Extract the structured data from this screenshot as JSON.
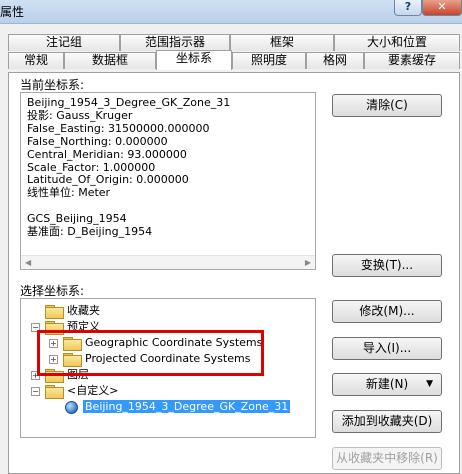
{
  "window": {
    "title": "属性",
    "help_label": "?",
    "close_label": "✕"
  },
  "tabs": {
    "row1": [
      "注记组",
      "范围指示器",
      "框架",
      "大小和位置"
    ],
    "row2": [
      "常规",
      "数据框",
      "坐标系",
      "照明度",
      "格网",
      "要素缓存"
    ],
    "active": "坐标系"
  },
  "current_cs": {
    "label": "当前坐标系:",
    "text": "Beijing_1954_3_Degree_GK_Zone_31\n投影: Gauss_Kruger\nFalse_Easting: 31500000.000000\nFalse_Northing: 0.000000\nCentral_Meridian: 93.000000\nScale_Factor: 1.000000\nLatitude_Of_Origin: 0.000000\n线性单位: Meter\n\nGCS_Beijing_1954\n基准面: D_Beijing_1954"
  },
  "select_cs": {
    "label": "选择坐标系:"
  },
  "tree": {
    "favorites": "收藏夹",
    "predefined": "预定义",
    "geographic": "Geographic Coordinate Systems",
    "projected": "Projected Coordinate Systems",
    "layers": "图层",
    "custom": "<自定义>",
    "custom_item": "Beijing_1954_3_Degree_GK_Zone_31"
  },
  "buttons": {
    "clear": "清除(C)",
    "transform": "变换(T)...",
    "modify": "修改(M)...",
    "import": "导入(I)...",
    "new": "新建(N)",
    "add_favorite": "添加到收藏夹(D)",
    "remove_favorite": "从收藏夹中移除(R)"
  },
  "icons": {
    "expand": "plus-box-icon",
    "collapse": "minus-box-icon",
    "folder": "folder-icon",
    "globe": "globe-icon"
  },
  "colors": {
    "highlight": "#e00000",
    "selection": "#3399ff"
  }
}
